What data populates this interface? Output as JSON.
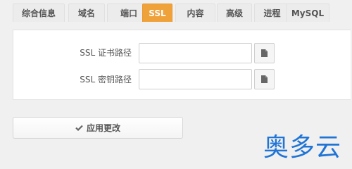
{
  "tabs": [
    {
      "label": "综合信息",
      "active": false
    },
    {
      "label": "域名",
      "active": false
    },
    {
      "label": "端口",
      "active": false
    },
    {
      "label": "SSL",
      "active": true
    },
    {
      "label": "内容",
      "active": false
    },
    {
      "label": "高级",
      "active": false
    },
    {
      "label": "进程",
      "active": false
    },
    {
      "label": "MySQL",
      "active": false
    }
  ],
  "ssl_form": {
    "cert_path_label": "SSL 证书路径",
    "cert_path_value": "",
    "key_path_label": "SSL 密钥路径",
    "key_path_value": ""
  },
  "apply_button_label": "应用更改",
  "watermark_text": "奥多云",
  "colors": {
    "active_tab": "#f0a23a",
    "watermark": "#1f74d6"
  },
  "icons": {
    "file_browse": "file-icon",
    "apply": "check-icon"
  }
}
